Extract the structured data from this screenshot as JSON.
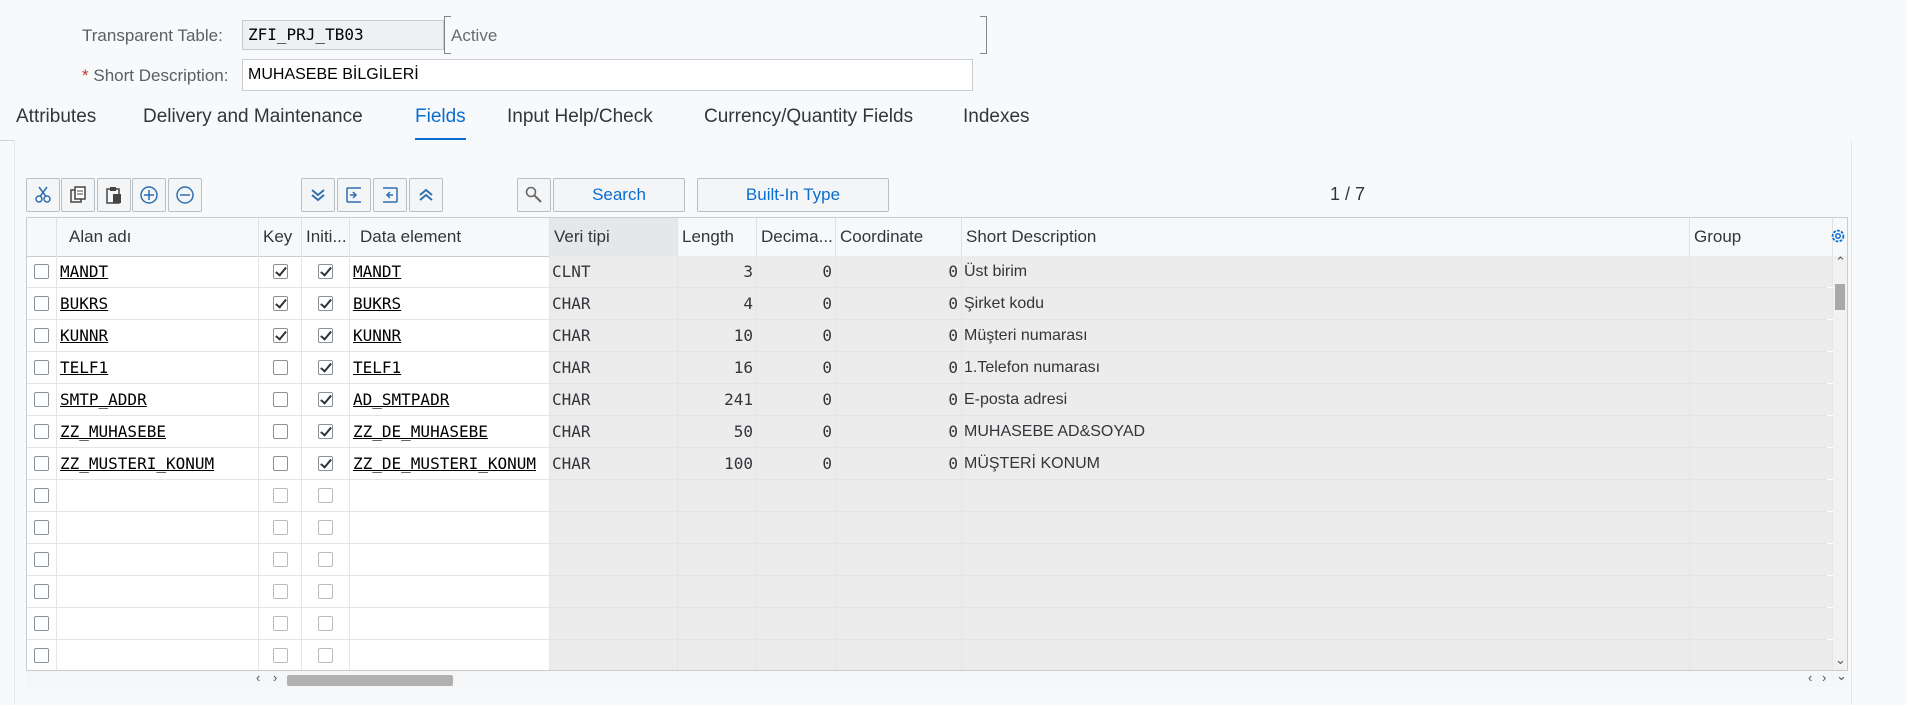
{
  "header": {
    "table_label": "Transparent Table:",
    "table_name": "ZFI_PRJ_TB03",
    "status": "Active",
    "desc_required": "*",
    "desc_label": "Short Description:",
    "desc_value": "MUHASEBE BİLGİLERİ"
  },
  "tabs": [
    {
      "label": "Attributes",
      "active": false
    },
    {
      "label": "Delivery and Maintenance",
      "active": false
    },
    {
      "label": "Fields",
      "active": true
    },
    {
      "label": "Input Help/Check",
      "active": false
    },
    {
      "label": "Currency/Quantity Fields",
      "active": false
    },
    {
      "label": "Indexes",
      "active": false
    }
  ],
  "toolbar": {
    "icons": [
      "cut-icon",
      "copy-icon",
      "paste-icon",
      "insert-row-icon",
      "delete-row-icon",
      "expand-all-icon",
      "insert-icon",
      "remove-icon",
      "collapse-all-icon",
      "search-help-icon"
    ],
    "search_label": "Search",
    "builtin_label": "Built-In Type",
    "pager": "1 / 7"
  },
  "columns": [
    "Alan adı",
    "Key",
    "Initi...",
    "Data element",
    "Veri tipi",
    "Length",
    "Decima...",
    "Coordinate",
    "Short Description",
    "Group"
  ],
  "rows": [
    {
      "field": "MANDT",
      "key": true,
      "init": true,
      "element": "MANDT",
      "type": "CLNT",
      "length": "3",
      "decimals": "0",
      "coord": "0",
      "desc": "Üst birim"
    },
    {
      "field": "BUKRS",
      "key": true,
      "init": true,
      "element": "BUKRS",
      "type": "CHAR",
      "length": "4",
      "decimals": "0",
      "coord": "0",
      "desc": "Şirket kodu"
    },
    {
      "field": "KUNNR",
      "key": true,
      "init": true,
      "element": "KUNNR",
      "type": "CHAR",
      "length": "10",
      "decimals": "0",
      "coord": "0",
      "desc": "Müşteri numarası"
    },
    {
      "field": "TELF1",
      "key": false,
      "init": true,
      "element": "TELF1",
      "type": "CHAR",
      "length": "16",
      "decimals": "0",
      "coord": "0",
      "desc": "1.Telefon numarası"
    },
    {
      "field": "SMTP_ADDR",
      "key": false,
      "init": true,
      "element": "AD_SMTPADR",
      "type": "CHAR",
      "length": "241",
      "decimals": "0",
      "coord": "0",
      "desc": "E-posta adresi"
    },
    {
      "field": "ZZ_MUHASEBE",
      "key": false,
      "init": true,
      "element": "ZZ_DE_MUHASEBE",
      "type": "CHAR",
      "length": "50",
      "decimals": "0",
      "coord": "0",
      "desc": "MUHASEBE AD&SOYAD"
    },
    {
      "field": "ZZ_MUSTERI_KONUM",
      "key": false,
      "init": true,
      "element": "ZZ_DE_MUSTERI_KONUM",
      "type": "CHAR",
      "length": "100",
      "decimals": "0",
      "coord": "0",
      "desc": "MÜŞTERİ KONUM"
    }
  ],
  "empty_rows": 6
}
